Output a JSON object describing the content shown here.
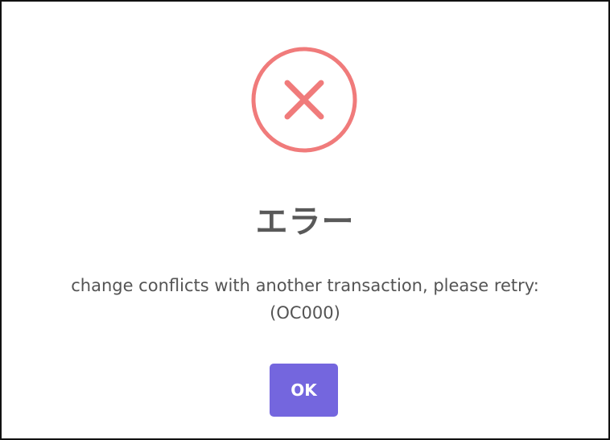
{
  "dialog": {
    "icon": "error-x-icon",
    "title": "エラー",
    "message_line1": "change conflicts with another transaction, please retry:",
    "message_line2": "(OC000)",
    "ok_label": "OK"
  },
  "colors": {
    "icon": "#f07b7b",
    "button": "#7466de",
    "text": "#545454",
    "border": "#111111"
  }
}
